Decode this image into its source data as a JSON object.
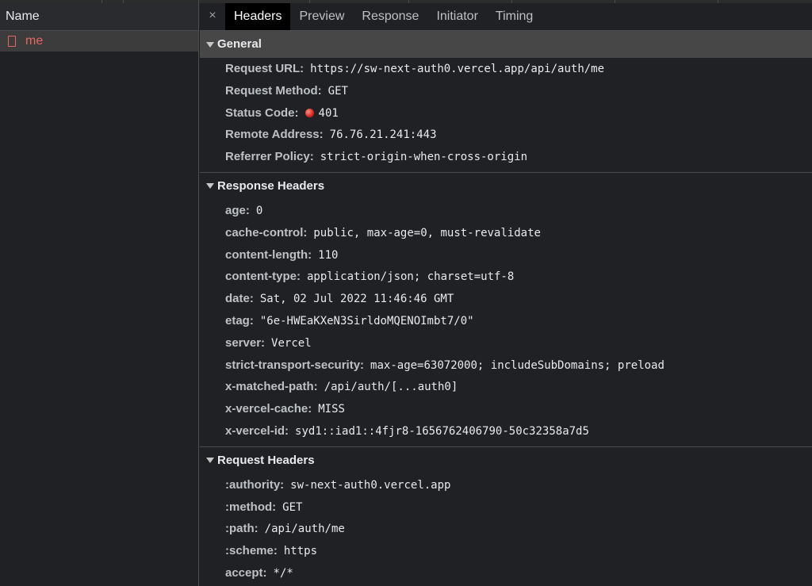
{
  "request_list": {
    "name_header": "Name",
    "requests": [
      {
        "name": "me",
        "icon": "document-icon"
      }
    ]
  },
  "tabs": {
    "close_icon": "×",
    "items": [
      "Headers",
      "Preview",
      "Response",
      "Initiator",
      "Timing"
    ],
    "active": "Headers"
  },
  "general": {
    "title": "General",
    "request_url_key": "Request URL:",
    "request_url_val": "https://sw-next-auth0.vercel.app/api/auth/me",
    "request_method_key": "Request Method:",
    "request_method_val": "GET",
    "status_code_key": "Status Code:",
    "status_code_val": "401",
    "status_color": "#d8281e",
    "remote_address_key": "Remote Address:",
    "remote_address_val": "76.76.21.241:443",
    "referrer_policy_key": "Referrer Policy:",
    "referrer_policy_val": "strict-origin-when-cross-origin"
  },
  "response_headers": {
    "title": "Response Headers",
    "age_key": "age:",
    "age_val": "0",
    "cache_control_key": "cache-control:",
    "cache_control_val": "public, max-age=0, must-revalidate",
    "content_length_key": "content-length:",
    "content_length_val": "110",
    "content_type_key": "content-type:",
    "content_type_val": "application/json; charset=utf-8",
    "date_key": "date:",
    "date_val": "Sat, 02 Jul 2022 11:46:46 GMT",
    "etag_key": "etag:",
    "etag_val": "\"6e-HWEaKXeN3SirldoMQENOImbt7/0\"",
    "server_key": "server:",
    "server_val": "Vercel",
    "sts_key": "strict-transport-security:",
    "sts_val": "max-age=63072000; includeSubDomains; preload",
    "matched_path_key": "x-matched-path:",
    "matched_path_val": "/api/auth/[...auth0]",
    "vercel_cache_key": "x-vercel-cache:",
    "vercel_cache_val": "MISS",
    "vercel_id_key": "x-vercel-id:",
    "vercel_id_val": "syd1::iad1::4fjr8-1656762406790-50c32358a7d5"
  },
  "request_headers": {
    "title": "Request Headers",
    "authority_key": ":authority:",
    "authority_val": "sw-next-auth0.vercel.app",
    "method_key": ":method:",
    "method_val": "GET",
    "path_key": ":path:",
    "path_val": "/api/auth/me",
    "scheme_key": ":scheme:",
    "scheme_val": "https",
    "accept_key": "accept:",
    "accept_val": "*/*"
  }
}
